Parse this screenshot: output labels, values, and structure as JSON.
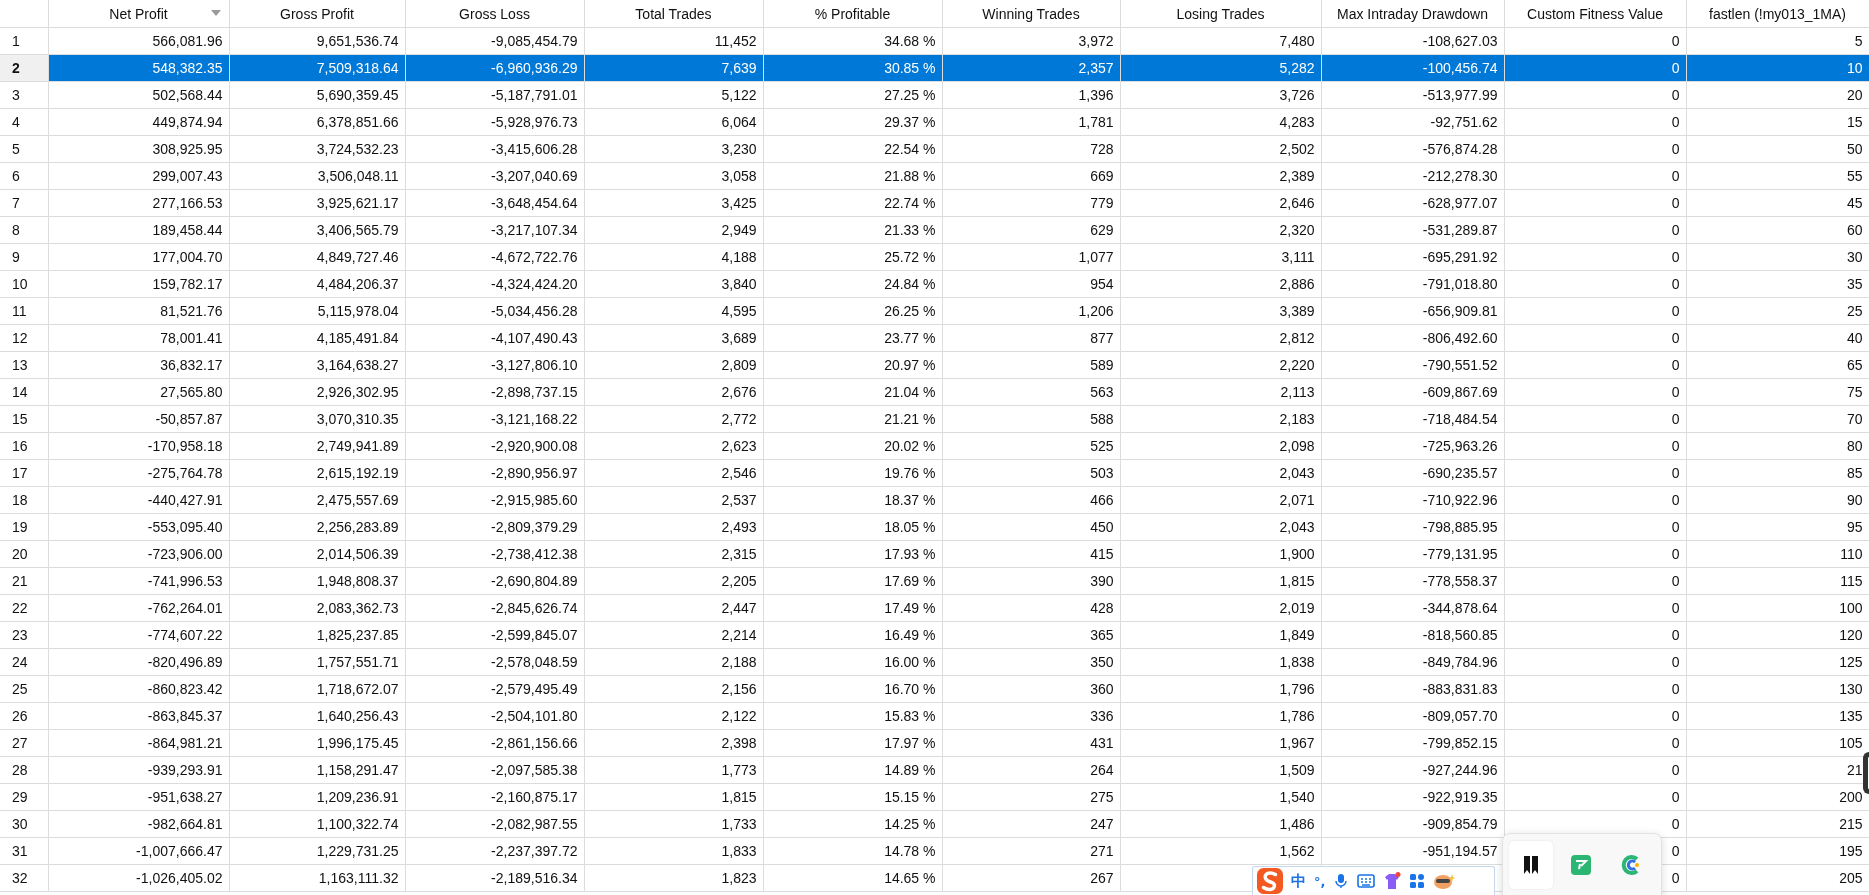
{
  "table": {
    "columns": [
      {
        "label": "Net Profit",
        "sort_desc": true
      },
      {
        "label": "Gross Profit",
        "sort_desc": false
      },
      {
        "label": "Gross Loss",
        "sort_desc": false
      },
      {
        "label": "Total Trades",
        "sort_desc": false
      },
      {
        "label": "% Profitable",
        "sort_desc": false
      },
      {
        "label": "Winning Trades",
        "sort_desc": false
      },
      {
        "label": "Losing Trades",
        "sort_desc": false
      },
      {
        "label": "Max Intraday Drawdown",
        "sort_desc": false
      },
      {
        "label": "Custom Fitness Value",
        "sort_desc": false
      },
      {
        "label": "fastlen (!my013_1MA)",
        "sort_desc": false
      }
    ],
    "rows": [
      {
        "num": "1",
        "selected": false,
        "cells": [
          "566,081.96",
          "9,651,536.74",
          "-9,085,454.79",
          "11,452",
          "34.68 %",
          "3,972",
          "7,480",
          "-108,627.03",
          "0",
          "5"
        ]
      },
      {
        "num": "2",
        "selected": true,
        "cells": [
          "548,382.35",
          "7,509,318.64",
          "-6,960,936.29",
          "7,639",
          "30.85 %",
          "2,357",
          "5,282",
          "-100,456.74",
          "0",
          "10"
        ]
      },
      {
        "num": "3",
        "selected": false,
        "cells": [
          "502,568.44",
          "5,690,359.45",
          "-5,187,791.01",
          "5,122",
          "27.25 %",
          "1,396",
          "3,726",
          "-513,977.99",
          "0",
          "20"
        ]
      },
      {
        "num": "4",
        "selected": false,
        "cells": [
          "449,874.94",
          "6,378,851.66",
          "-5,928,976.73",
          "6,064",
          "29.37 %",
          "1,781",
          "4,283",
          "-92,751.62",
          "0",
          "15"
        ]
      },
      {
        "num": "5",
        "selected": false,
        "cells": [
          "308,925.95",
          "3,724,532.23",
          "-3,415,606.28",
          "3,230",
          "22.54 %",
          "728",
          "2,502",
          "-576,874.28",
          "0",
          "50"
        ]
      },
      {
        "num": "6",
        "selected": false,
        "cells": [
          "299,007.43",
          "3,506,048.11",
          "-3,207,040.69",
          "3,058",
          "21.88 %",
          "669",
          "2,389",
          "-212,278.30",
          "0",
          "55"
        ]
      },
      {
        "num": "7",
        "selected": false,
        "cells": [
          "277,166.53",
          "3,925,621.17",
          "-3,648,454.64",
          "3,425",
          "22.74 %",
          "779",
          "2,646",
          "-628,977.07",
          "0",
          "45"
        ]
      },
      {
        "num": "8",
        "selected": false,
        "cells": [
          "189,458.44",
          "3,406,565.79",
          "-3,217,107.34",
          "2,949",
          "21.33 %",
          "629",
          "2,320",
          "-531,289.87",
          "0",
          "60"
        ]
      },
      {
        "num": "9",
        "selected": false,
        "cells": [
          "177,004.70",
          "4,849,727.46",
          "-4,672,722.76",
          "4,188",
          "25.72 %",
          "1,077",
          "3,111",
          "-695,291.92",
          "0",
          "30"
        ]
      },
      {
        "num": "10",
        "selected": false,
        "cells": [
          "159,782.17",
          "4,484,206.37",
          "-4,324,424.20",
          "3,840",
          "24.84 %",
          "954",
          "2,886",
          "-791,018.80",
          "0",
          "35"
        ]
      },
      {
        "num": "11",
        "selected": false,
        "cells": [
          "81,521.76",
          "5,115,978.04",
          "-5,034,456.28",
          "4,595",
          "26.25 %",
          "1,206",
          "3,389",
          "-656,909.81",
          "0",
          "25"
        ]
      },
      {
        "num": "12",
        "selected": false,
        "cells": [
          "78,001.41",
          "4,185,491.84",
          "-4,107,490.43",
          "3,689",
          "23.77 %",
          "877",
          "2,812",
          "-806,492.60",
          "0",
          "40"
        ]
      },
      {
        "num": "13",
        "selected": false,
        "cells": [
          "36,832.17",
          "3,164,638.27",
          "-3,127,806.10",
          "2,809",
          "20.97 %",
          "589",
          "2,220",
          "-790,551.52",
          "0",
          "65"
        ]
      },
      {
        "num": "14",
        "selected": false,
        "cells": [
          "27,565.80",
          "2,926,302.95",
          "-2,898,737.15",
          "2,676",
          "21.04 %",
          "563",
          "2,113",
          "-609,867.69",
          "0",
          "75"
        ]
      },
      {
        "num": "15",
        "selected": false,
        "cells": [
          "-50,857.87",
          "3,070,310.35",
          "-3,121,168.22",
          "2,772",
          "21.21 %",
          "588",
          "2,183",
          "-718,484.54",
          "0",
          "70"
        ]
      },
      {
        "num": "16",
        "selected": false,
        "cells": [
          "-170,958.18",
          "2,749,941.89",
          "-2,920,900.08",
          "2,623",
          "20.02 %",
          "525",
          "2,098",
          "-725,963.26",
          "0",
          "80"
        ]
      },
      {
        "num": "17",
        "selected": false,
        "cells": [
          "-275,764.78",
          "2,615,192.19",
          "-2,890,956.97",
          "2,546",
          "19.76 %",
          "503",
          "2,043",
          "-690,235.57",
          "0",
          "85"
        ]
      },
      {
        "num": "18",
        "selected": false,
        "cells": [
          "-440,427.91",
          "2,475,557.69",
          "-2,915,985.60",
          "2,537",
          "18.37 %",
          "466",
          "2,071",
          "-710,922.96",
          "0",
          "90"
        ]
      },
      {
        "num": "19",
        "selected": false,
        "cells": [
          "-553,095.40",
          "2,256,283.89",
          "-2,809,379.29",
          "2,493",
          "18.05 %",
          "450",
          "2,043",
          "-798,885.95",
          "0",
          "95"
        ]
      },
      {
        "num": "20",
        "selected": false,
        "cells": [
          "-723,906.00",
          "2,014,506.39",
          "-2,738,412.38",
          "2,315",
          "17.93 %",
          "415",
          "1,900",
          "-779,131.95",
          "0",
          "110"
        ]
      },
      {
        "num": "21",
        "selected": false,
        "cells": [
          "-741,996.53",
          "1,948,808.37",
          "-2,690,804.89",
          "2,205",
          "17.69 %",
          "390",
          "1,815",
          "-778,558.37",
          "0",
          "115"
        ]
      },
      {
        "num": "22",
        "selected": false,
        "cells": [
          "-762,264.01",
          "2,083,362.73",
          "-2,845,626.74",
          "2,447",
          "17.49 %",
          "428",
          "2,019",
          "-344,878.64",
          "0",
          "100"
        ]
      },
      {
        "num": "23",
        "selected": false,
        "cells": [
          "-774,607.22",
          "1,825,237.85",
          "-2,599,845.07",
          "2,214",
          "16.49 %",
          "365",
          "1,849",
          "-818,560.85",
          "0",
          "120"
        ]
      },
      {
        "num": "24",
        "selected": false,
        "cells": [
          "-820,496.89",
          "1,757,551.71",
          "-2,578,048.59",
          "2,188",
          "16.00 %",
          "350",
          "1,838",
          "-849,784.96",
          "0",
          "125"
        ]
      },
      {
        "num": "25",
        "selected": false,
        "cells": [
          "-860,823.42",
          "1,718,672.07",
          "-2,579,495.49",
          "2,156",
          "16.70 %",
          "360",
          "1,796",
          "-883,831.83",
          "0",
          "130"
        ]
      },
      {
        "num": "26",
        "selected": false,
        "cells": [
          "-863,845.37",
          "1,640,256.43",
          "-2,504,101.80",
          "2,122",
          "15.83 %",
          "336",
          "1,786",
          "-809,057.70",
          "0",
          "135"
        ]
      },
      {
        "num": "27",
        "selected": false,
        "cells": [
          "-864,981.21",
          "1,996,175.45",
          "-2,861,156.66",
          "2,398",
          "17.97 %",
          "431",
          "1,967",
          "-799,852.15",
          "0",
          "105"
        ]
      },
      {
        "num": "28",
        "selected": false,
        "cells": [
          "-939,293.91",
          "1,158,291.47",
          "-2,097,585.38",
          "1,773",
          "14.89 %",
          "264",
          "1,509",
          "-927,244.96",
          "0",
          "21"
        ]
      },
      {
        "num": "29",
        "selected": false,
        "cells": [
          "-951,638.27",
          "1,209,236.91",
          "-2,160,875.17",
          "1,815",
          "15.15 %",
          "275",
          "1,540",
          "-922,919.35",
          "0",
          "200"
        ]
      },
      {
        "num": "30",
        "selected": false,
        "cells": [
          "-982,664.81",
          "1,100,322.74",
          "-2,082,987.55",
          "1,733",
          "14.25 %",
          "247",
          "1,486",
          "-909,854.79",
          "0",
          "215"
        ]
      },
      {
        "num": "31",
        "selected": false,
        "cells": [
          "-1,007,666.47",
          "1,229,731.25",
          "-2,237,397.72",
          "1,833",
          "14.78 %",
          "271",
          "1,562",
          "-951,194.57",
          "0",
          "195"
        ]
      },
      {
        "num": "32",
        "selected": false,
        "cells": [
          "-1,026,405.02",
          "1,163,111.32",
          "-2,189,516.34",
          "1,823",
          "14.65 %",
          "267",
          null,
          null,
          "0",
          "205"
        ]
      }
    ]
  },
  "ime_toolbar": {
    "mode": "中",
    "punctuation": "°,"
  }
}
